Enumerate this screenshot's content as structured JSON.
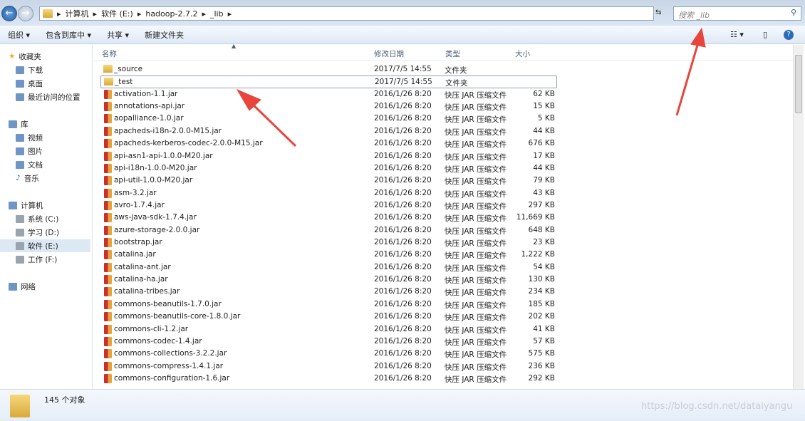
{
  "address": {
    "crumbs": [
      "计算机",
      "软件 (E:)",
      "hadoop-2.7.2",
      "_lib"
    ],
    "search_placeholder": "搜索 _lib"
  },
  "toolbar": {
    "organize": "组织 ▾",
    "include": "包含到库中 ▾",
    "share": "共享 ▾",
    "new_folder": "新建文件夹"
  },
  "sidebar": {
    "favorites": "收藏夹",
    "fav_items": [
      "下载",
      "桌面",
      "最近访问的位置"
    ],
    "libraries": "库",
    "lib_items": [
      "视频",
      "图片",
      "文档",
      "音乐"
    ],
    "computer": "计算机",
    "drives": [
      "系统 (C:)",
      "学习 (D:)",
      "软件 (E:)",
      "工作 (F:)"
    ],
    "network": "网络"
  },
  "columns": {
    "name": "名称",
    "date": "修改日期",
    "type": "类型",
    "size": "大小"
  },
  "files": [
    [
      "_source",
      "2017/7/5 14:55",
      "文件夹",
      ""
    ],
    [
      "_test",
      "2017/7/5 14:55",
      "文件夹",
      ""
    ],
    [
      "activation-1.1.jar",
      "2016/1/26 8:20",
      "快压 JAR 压缩文件",
      "62 KB"
    ],
    [
      "annotations-api.jar",
      "2016/1/26 8:20",
      "快压 JAR 压缩文件",
      "15 KB"
    ],
    [
      "aopalliance-1.0.jar",
      "2016/1/26 8:20",
      "快压 JAR 压缩文件",
      "5 KB"
    ],
    [
      "apacheds-i18n-2.0.0-M15.jar",
      "2016/1/26 8:20",
      "快压 JAR 压缩文件",
      "44 KB"
    ],
    [
      "apacheds-kerberos-codec-2.0.0-M15.jar",
      "2016/1/26 8:20",
      "快压 JAR 压缩文件",
      "676 KB"
    ],
    [
      "api-asn1-api-1.0.0-M20.jar",
      "2016/1/26 8:20",
      "快压 JAR 压缩文件",
      "17 KB"
    ],
    [
      "api-i18n-1.0.0-M20.jar",
      "2016/1/26 8:20",
      "快压 JAR 压缩文件",
      "44 KB"
    ],
    [
      "api-util-1.0.0-M20.jar",
      "2016/1/26 8:20",
      "快压 JAR 压缩文件",
      "79 KB"
    ],
    [
      "asm-3.2.jar",
      "2016/1/26 8:20",
      "快压 JAR 压缩文件",
      "43 KB"
    ],
    [
      "avro-1.7.4.jar",
      "2016/1/26 8:20",
      "快压 JAR 压缩文件",
      "297 KB"
    ],
    [
      "aws-java-sdk-1.7.4.jar",
      "2016/1/26 8:20",
      "快压 JAR 压缩文件",
      "11,669 KB"
    ],
    [
      "azure-storage-2.0.0.jar",
      "2016/1/26 8:20",
      "快压 JAR 压缩文件",
      "648 KB"
    ],
    [
      "bootstrap.jar",
      "2016/1/26 8:20",
      "快压 JAR 压缩文件",
      "23 KB"
    ],
    [
      "catalina.jar",
      "2016/1/26 8:20",
      "快压 JAR 压缩文件",
      "1,222 KB"
    ],
    [
      "catalina-ant.jar",
      "2016/1/26 8:20",
      "快压 JAR 压缩文件",
      "54 KB"
    ],
    [
      "catalina-ha.jar",
      "2016/1/26 8:20",
      "快压 JAR 压缩文件",
      "130 KB"
    ],
    [
      "catalina-tribes.jar",
      "2016/1/26 8:20",
      "快压 JAR 压缩文件",
      "234 KB"
    ],
    [
      "commons-beanutils-1.7.0.jar",
      "2016/1/26 8:20",
      "快压 JAR 压缩文件",
      "185 KB"
    ],
    [
      "commons-beanutils-core-1.8.0.jar",
      "2016/1/26 8:20",
      "快压 JAR 压缩文件",
      "202 KB"
    ],
    [
      "commons-cli-1.2.jar",
      "2016/1/26 8:20",
      "快压 JAR 压缩文件",
      "41 KB"
    ],
    [
      "commons-codec-1.4.jar",
      "2016/1/26 8:20",
      "快压 JAR 压缩文件",
      "57 KB"
    ],
    [
      "commons-collections-3.2.2.jar",
      "2016/1/26 8:20",
      "快压 JAR 压缩文件",
      "575 KB"
    ],
    [
      "commons-compress-1.4.1.jar",
      "2016/1/26 8:20",
      "快压 JAR 压缩文件",
      "236 KB"
    ],
    [
      "commons-configuration-1.6.jar",
      "2016/1/26 8:20",
      "快压 JAR 压缩文件",
      "292 KB"
    ]
  ],
  "status": {
    "count": "145 个对象"
  },
  "watermark": "https://blog.csdn.net/dataiyangu",
  "colors": {
    "arrow": "#e8453c"
  }
}
